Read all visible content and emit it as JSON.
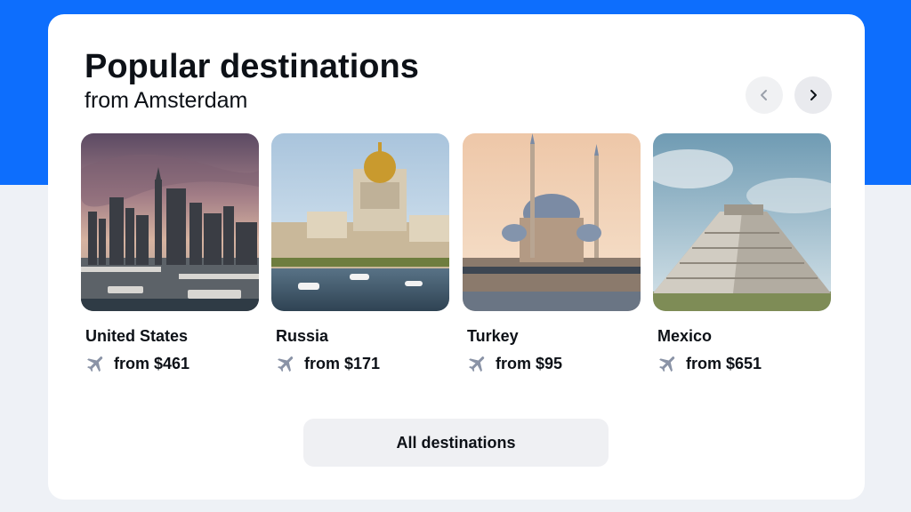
{
  "header": {
    "title": "Popular destinations",
    "subtitle": "from Amsterdam"
  },
  "navigation": {
    "prev_icon": "chevron-left-icon",
    "next_icon": "chevron-right-icon"
  },
  "destinations": [
    {
      "name": "United States",
      "price": "from $461",
      "icon": "airplane-icon"
    },
    {
      "name": "Russia",
      "price": "from $171",
      "icon": "airplane-icon"
    },
    {
      "name": "Turkey",
      "price": "from $95",
      "icon": "airplane-icon"
    },
    {
      "name": "Mexico",
      "price": "from $651",
      "icon": "airplane-icon"
    }
  ],
  "footer": {
    "all_destinations_label": "All destinations"
  },
  "colors": {
    "brand_blue": "#0d6efd",
    "page_bottom": "#eef1f6",
    "text": "#0d1117",
    "plane_icon": "#8a93a6"
  }
}
